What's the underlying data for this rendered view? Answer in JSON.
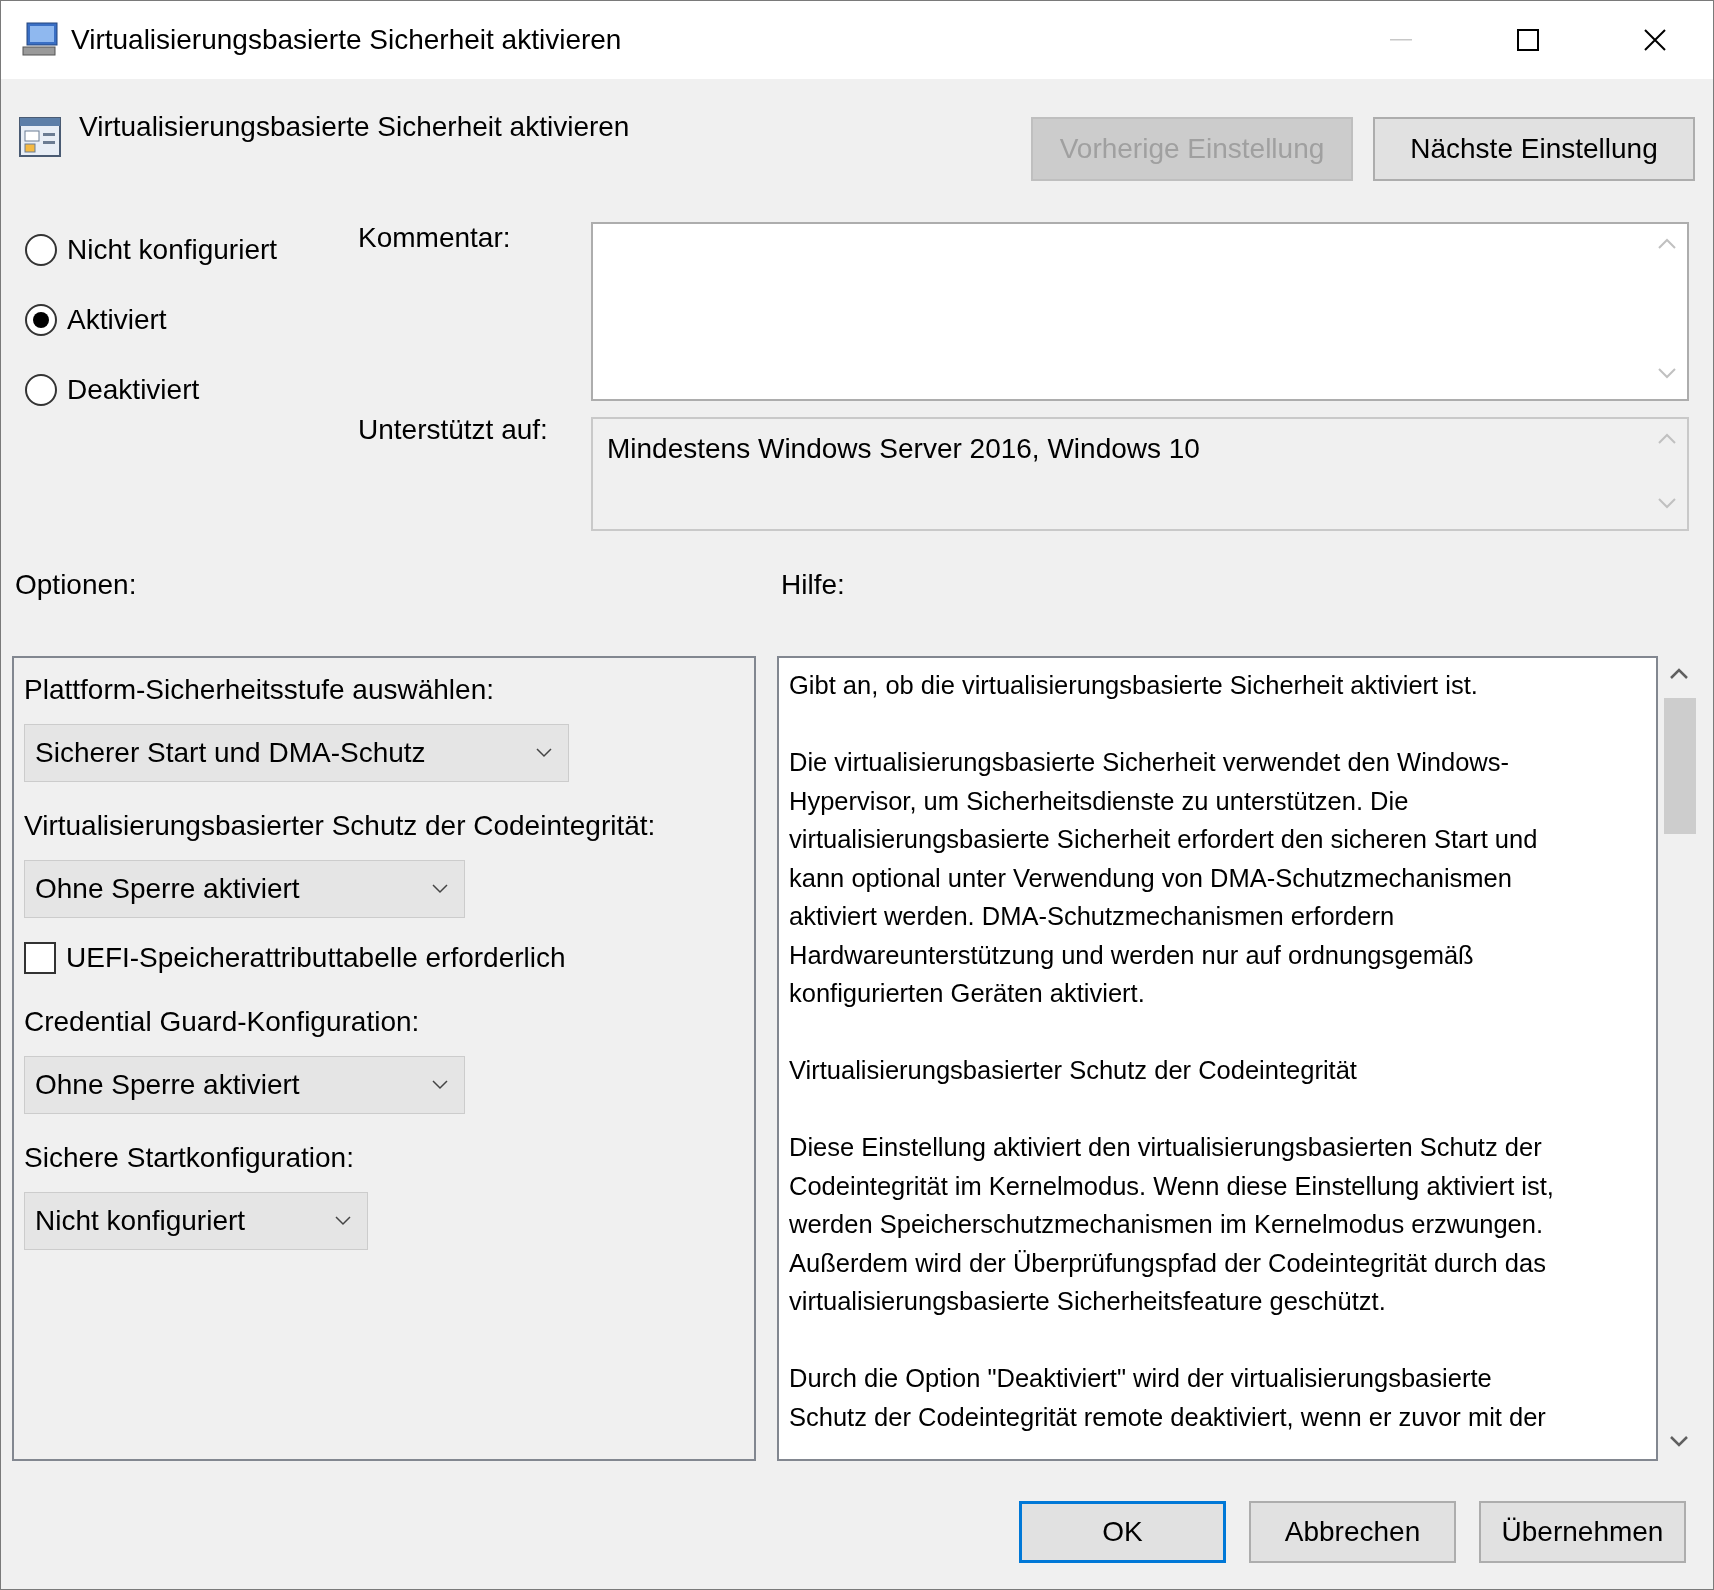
{
  "window": {
    "title": "Virtualisierungsbasierte Sicherheit aktivieren"
  },
  "header": {
    "title": "Virtualisierungsbasierte Sicherheit aktivieren",
    "buttons": [
      {
        "label": "Vorherige Einstellung",
        "disabled": true
      },
      {
        "label": "Nächste Einstellung",
        "disabled": false
      }
    ]
  },
  "state_options": [
    {
      "label": "Nicht konfiguriert",
      "selected": false
    },
    {
      "label": "Aktiviert",
      "selected": true
    },
    {
      "label": "Deaktiviert",
      "selected": false
    }
  ],
  "comment": {
    "label": "Kommentar:"
  },
  "supported": {
    "label": "Unterstützt auf:",
    "value": "Mindestens Windows Server 2016, Windows 10"
  },
  "options": {
    "label": "Optionen:",
    "items": [
      {
        "kind": "dropdown",
        "label": "Plattform-Sicherheitsstufe auswählen:",
        "value": "Sicherer Start und DMA-Schutz"
      },
      {
        "kind": "dropdown",
        "label": "Virtualisierungsbasierter Schutz der Codeintegrität:",
        "value": "Ohne Sperre aktiviert"
      },
      {
        "kind": "checkbox",
        "label": "UEFI-Speicherattributtabelle erforderlich",
        "checked": false
      },
      {
        "kind": "dropdown",
        "label": "Credential Guard-Konfiguration:",
        "value": "Ohne Sperre aktiviert"
      },
      {
        "kind": "dropdown",
        "label": "Sichere Startkonfiguration:",
        "value": "Nicht konfiguriert"
      }
    ]
  },
  "help": {
    "label": "Hilfe:",
    "paragraphs": [
      [
        "Gibt an, ob die virtualisierungsbasierte Sicherheit aktiviert ist."
      ],
      [
        "Die virtualisierungsbasierte Sicherheit verwendet den Windows-",
        "Hypervisor, um Sicherheitsdienste zu unterstützen. Die",
        "virtualisierungsbasierte Sicherheit erfordert den sicheren Start und",
        "kann optional unter Verwendung von DMA-Schutzmechanismen",
        "aktiviert werden. DMA-Schutzmechanismen erfordern",
        "Hardwareunterstützung und werden nur auf ordnungsgemäß",
        "konfigurierten Geräten aktiviert."
      ],
      [
        "Virtualisierungsbasierter Schutz der Codeintegrität"
      ],
      [
        "Diese Einstellung aktiviert den virtualisierungsbasierten Schutz der",
        "Codeintegrität im Kernelmodus. Wenn diese Einstellung aktiviert ist,",
        "werden Speicherschutzmechanismen im Kernelmodus erzwungen.",
        "Außerdem wird der Überprüfungspfad der Codeintegrität durch das",
        "virtualisierungsbasierte Sicherheitsfeature geschützt."
      ],
      [
        "Durch die Option \"Deaktiviert\" wird der virtualisierungsbasierte",
        "Schutz der Codeintegrität remote deaktiviert, wenn er zuvor mit der"
      ]
    ]
  },
  "buttons": [
    {
      "label": "OK",
      "default": true
    },
    {
      "label": "Abbrechen",
      "default": false
    },
    {
      "label": "Übernehmen",
      "default": false
    }
  ]
}
